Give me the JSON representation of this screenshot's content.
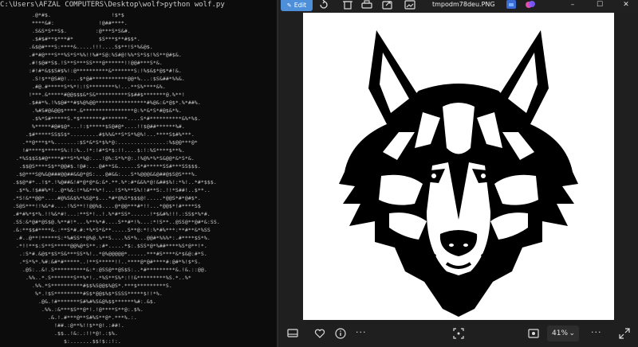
{
  "terminal": {
    "command": "C:\\Users\\AFZAL COMPUTERS\\Desktop\\wolf>python wolf.py",
    "ascii_lines": [
      "          .@*#$.                   !$*$",
      "          ****&#:              !@##****.",
      "          .S&S*S**S$.         :@***S*S&#.",
      "          .$#$#**$***#*        $S***$**#$$*.",
      "         .&$@#***S:****&.....!!!....S$**!S*%&@$.",
      "         .#*#@***S**%S*S*%%!!%#*S@:%S#@!%%*S*S$!%S**@#$&.",
      "         .#!$@#*S$.!S**S***SS***@******!!@@#***S*&.",
      "         :#!#*&$$S#$%!:@**********&*******S:!%$&$*@$*#!&.",
      "          .S!$**@S#@!....$*@#***********@@*%...:$S&##*%%&.",
      "          .#@.#*****S*%*!:!S********%!...**S%****&%.",
      "         !***.&*****#@@$$$&*S&**********S$##$*******@.%**!",
      "         .$##*%.!%$@#**#$%@%@@****************#%@&:&*@$*.%*##%.",
      "          .%#S#@&@@$****.&****************@:%*&*S*#@$&*%.",
      "          .$%*S#*****S.*$*******#*******....S*#**********&%*%$.",
      "          %*****#@#$@*...!:$*****$S@#@*....!!$@##******%#.",
      "        .$#*****SS$S$*.........#$%%&**S*S*%@%!...****S$#%***.",
      "       .**@***$*%.......:$S*&*S*$%*@:...............:%$@@***@*",
      "       !#****$*****S%:!:%..!*:!#*S*$:!!....$:!:%S****$**%.",
      "     .*%S$$S$#@****#**S*%*%@:...!@%:S*%*@:.!%@%*%*S&@@*&*S*&.",
      "      .$$@S****S$**@@#$.!@#:...@#**S&......S*#*****SS#***SS$$$.",
      "     .$@***S@%&@###@@##&&@*@S:...@#&&:...S*%@@@&&@##@$S@S***%.",
      "    .$$@*#*..!$*.!%@##&!#*@*@*&:&*.**.%*:#*&&%*@!&##$%!:*%!..*#*$$$.",
      "     .$*%.!$##%*!..@*%&:!*%&**%*!...!S*%**S%!!#**S:.!!*S##!..$**..",
      "    .*S!&**@@*....#@%S&$%*%S@*$...*#*@%S*$$$@!.....*@@S*#*@#$*.",
      "    .S@S***!!%&*#....!%S**!!@@%$....@*@@***#*!!...*@@$*!#****S$",
      "    .#*#%*$*%.!!%&*#!...:**S*!..!.%*#*SS*......!*$&#%!!!.:SS$*%*#.",
      "    .SS:&*@#*@S$@.%**#!*...%**%*#....S**#*!%...:*!S**..@SS@**@#*&:SS.",
      "    .&:**$$#****&.:**S*#.#:*%*S*&**.....S**@:*!:%*#%***:**#**&*%SS",
      "     .#..@**!*****S:*%#SS**@%@.%**S....%S*%...@@#*%%%*:.#****$S*%.",
      "     .*!!**$:S**S*****@@%@*S**.:#*.....*$:.$SS*@*%##****%S*@**!*.",
      "      .:S*#.&@$*$S*S&***SS*%!..*@%@@@@@*......***#S****&*$&@:#*S.",
      "      .*S*%*.%#:&#*#*****..!**S*****!!..****@*@#****#:@#*%!$*S.",
      "       .@S:..&!.S**********&:*:@SS@**@S$S:..*#*********&.!&.::@@.",
      "        .%%..*.S*******S**%*!..*%S**S%*:!!&*********%S.*..%*",
      "          .%%.*S**********#$$%S@@$%@S*.***$*********S.",
      "           %*.!$S*********#S$*@@$%$*SSSS*****$!!*%.",
      "            .@&.!#*******S#%#%S&@%$$******%#:.&$.",
      "             .%%.:&***$S**@*!.!@****S**@:.$%.",
      "               .&.!.#***@**S#%S**@*.***%.:.",
      "                 !##.:@**%!!$**@!.:##!.",
      "                 .$$..!&:.:!!*@!.:$%.",
      "                    $:.......$$!$::!:."
    ]
  },
  "viewer": {
    "edit_label": "Edit",
    "file_name": "tmpodm78deu.PNG",
    "zoom_value": "41%",
    "toolbar_icons": [
      "rotate-icon",
      "delete-icon",
      "print-icon",
      "share-icon",
      "edit-image-icon",
      "favorite-icon",
      "more-icon",
      "minimize-icon",
      "maximize-icon",
      "close-icon"
    ],
    "bottom_icons": [
      "filmstrip-icon",
      "heart-icon",
      "info-icon",
      "more-icon",
      "fit-icon",
      "zoom-frame-icon",
      "more-icon",
      "fullscreen-icon"
    ],
    "wolf_fill": "#000000",
    "image_bg": "#ffffff",
    "accent": "#4d8fd9"
  }
}
